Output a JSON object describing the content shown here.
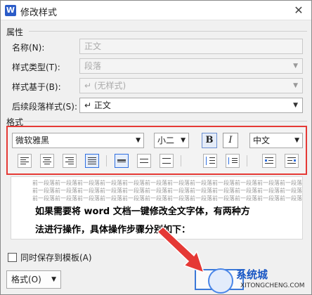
{
  "title": "修改样式",
  "app_icon_letter": "W",
  "sections": {
    "properties": "属性",
    "format": "格式"
  },
  "properties": {
    "name_label": "名称(N):",
    "name_value": "正文",
    "style_type_label": "样式类型(T):",
    "style_type_value": "段落",
    "based_on_label": "样式基于(B):",
    "based_on_value": "↵ (无样式)",
    "next_style_label": "后续段落样式(S):",
    "next_style_value": "↵ 正文"
  },
  "format_toolbar": {
    "font_name": "微软雅黑",
    "font_size": "小二",
    "bold": "B",
    "italic": "I",
    "language": "中文"
  },
  "preview": {
    "ghost_line": "前一段落前一段落前一段落前一段落前一段落前一段落前一段落前一段落前一段落前一段落前一段落前一段落",
    "line1": "如果需要将 word 文档一键修改全文字体，有两种方",
    "line2": "法进行操作，具体操作步骤分别如下："
  },
  "footer": {
    "save_template_label": "同时保存到模板(A)",
    "format_button_label": "格式(O)"
  },
  "watermark": {
    "name": "系统城",
    "url": "XITONGCHENG.COM"
  },
  "colors": {
    "highlight_border": "#e53935",
    "ok_button_border": "#3a78d8",
    "annotation_arrow": "#e53935"
  }
}
